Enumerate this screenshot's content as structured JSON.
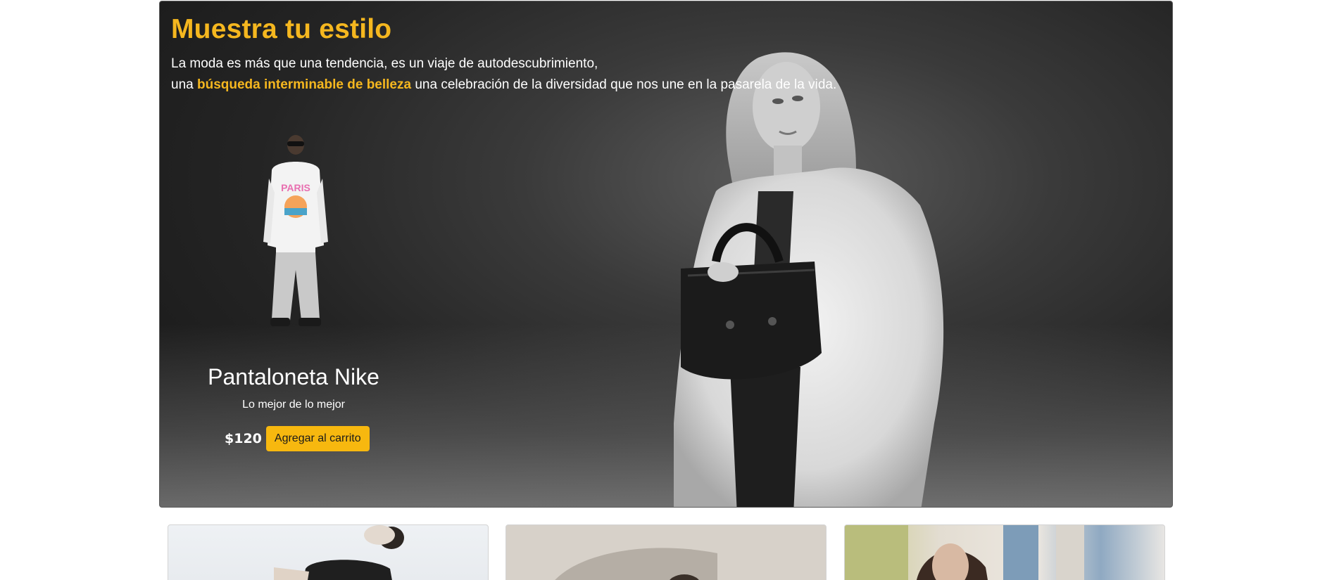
{
  "hero": {
    "title": "Muestra tu estilo",
    "text_line1": "La moda es más que una tendencia, es un viaje de autodescubrimiento,",
    "text_line2_prefix": "una ",
    "text_line2_highlight": "búsqueda interminable de belleza",
    "text_line2_suffix": " una celebración de la diversidad que nos une en la pasarela de la vida."
  },
  "product": {
    "name": "Pantaloneta Nike",
    "description": "Lo mejor de lo mejor",
    "price": "$120",
    "cart_button": "Agregar al carrito"
  },
  "colors": {
    "accent": "#f5b71f",
    "button": "#f7b80f"
  }
}
